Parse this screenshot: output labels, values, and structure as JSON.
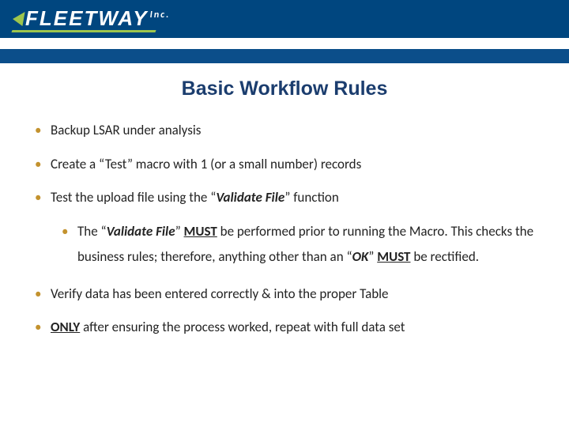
{
  "brand": {
    "name": "FLEETWAY",
    "suffix": "Inc."
  },
  "title": "Basic Workflow Rules",
  "bullets": {
    "b1": "Backup LSAR under analysis",
    "b2": "Create a “Test” macro with 1 (or a small number) records",
    "b3_a": "Test the upload file using the “",
    "b3_vf": "Validate File",
    "b3_b": "” function",
    "b3s_a": "The “",
    "b3s_vf": "Validate File",
    "b3s_b": "” ",
    "b3s_must1": "MUST",
    "b3s_c": " be performed prior to running the Macro. This checks the business rules; therefore, anything other than an “",
    "b3s_ok": "OK",
    "b3s_d": "” ",
    "b3s_must2": "MUST",
    "b3s_e": " be rectified.",
    "b4": "Verify data has been entered correctly & into the proper Table",
    "b5_only": "ONLY",
    "b5_rest": " after ensuring the process worked, repeat with full data set"
  }
}
